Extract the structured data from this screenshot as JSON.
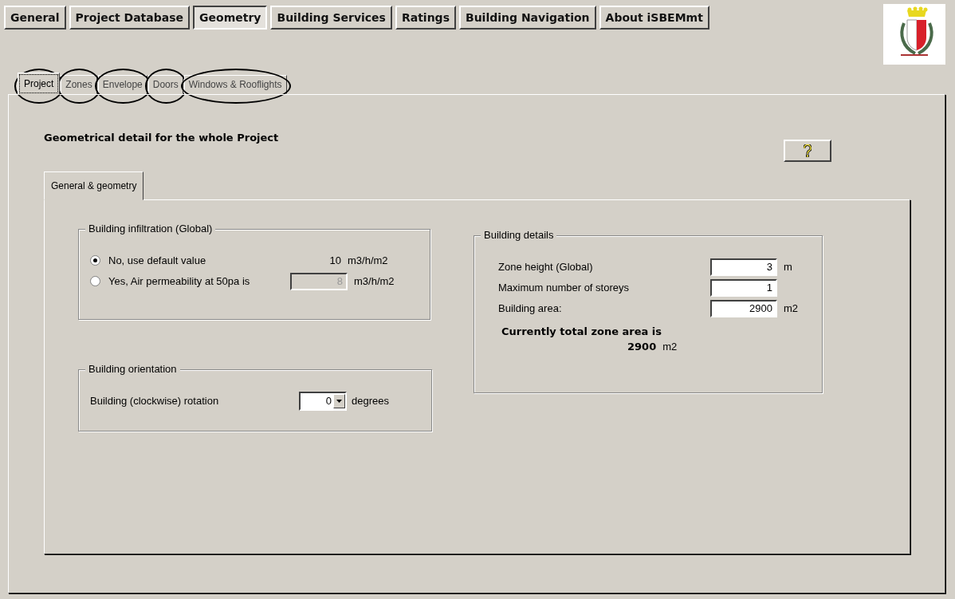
{
  "main_tabs": [
    {
      "label": "General",
      "selected": false
    },
    {
      "label": "Project Database",
      "selected": false
    },
    {
      "label": "Geometry",
      "selected": true
    },
    {
      "label": "Building Services",
      "selected": false
    },
    {
      "label": "Ratings",
      "selected": false
    },
    {
      "label": "Building Navigation",
      "selected": false
    },
    {
      "label": "About iSBEMmt",
      "selected": false
    }
  ],
  "sub_tabs": [
    {
      "label": "Project",
      "selected": true,
      "circled": true
    },
    {
      "label": "Zones",
      "selected": false,
      "circled": true
    },
    {
      "label": "Envelope",
      "selected": false,
      "circled": true
    },
    {
      "label": "Doors",
      "selected": false,
      "circled": true
    },
    {
      "label": "Windows & Rooflights",
      "selected": false,
      "circled": true
    }
  ],
  "heading": "Geometrical detail for the whole Project",
  "inner_tabs": [
    {
      "label": "General & geometry",
      "selected": true
    }
  ],
  "infiltration": {
    "title": "Building infiltration (Global)",
    "options": [
      {
        "kind": "text",
        "label": "No, use default value",
        "selected": true,
        "value": "10",
        "unit": "m3/h/m2"
      },
      {
        "kind": "field",
        "label": "Yes, Air permeability at 50pa is",
        "selected": false,
        "value": "8",
        "unit": "m3/h/m2",
        "disabled": true
      }
    ]
  },
  "orientation": {
    "title": "Building orientation",
    "label": "Building (clockwise) rotation",
    "value": "0",
    "unit": "degrees"
  },
  "details": {
    "title": "Building details",
    "fields": [
      {
        "label": "Zone height (Global)",
        "value": "3",
        "unit": "m"
      },
      {
        "label": "Maximum number of storeys",
        "value": "1"
      },
      {
        "label": "Building area:",
        "value": "2900",
        "unit": "m2"
      }
    ],
    "total_label": "Currently total zone area is",
    "total_value": "2900",
    "total_unit": "m2"
  }
}
